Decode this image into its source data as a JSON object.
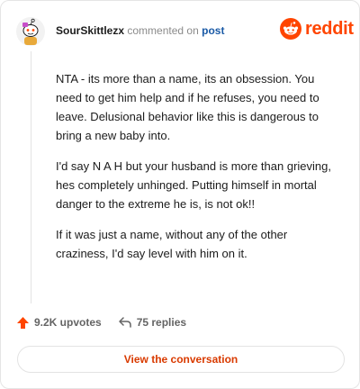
{
  "header": {
    "username": "SourSkittlezx",
    "action": "commented on",
    "post_link": "post",
    "brand": "reddit"
  },
  "comment": {
    "paragraphs": [
      "NTA - its more than a name, its an obsession. You need to get him help and if he refuses, you need to leave. Delusional behavior like this is dangerous to bring a new baby into.",
      "I'd say N A H but your husband is more than grieving, hes completely unhinged. Putting himself in mortal danger to the extreme he is, is not ok!!",
      "If it was just a name, without any of the other craziness, I'd say level with him on it."
    ]
  },
  "footer": {
    "upvotes": "9.2K upvotes",
    "replies": "75 replies",
    "view_button": "View the conversation"
  },
  "icons": {
    "avatar": "snoo-avatar-icon",
    "logo": "reddit-logo-icon",
    "upvote": "upvote-arrow-icon",
    "reply": "reply-arrow-icon"
  },
  "colors": {
    "brand": "#ff4500",
    "link": "#1a5aa6",
    "button_text": "#d93a00"
  }
}
